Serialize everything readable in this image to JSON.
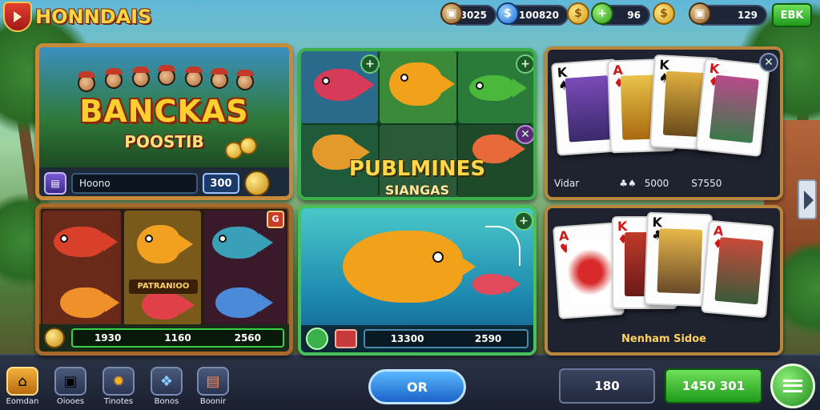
{
  "header": {
    "brand": "HONNDAIS",
    "stats": [
      {
        "icon": "chest-icon",
        "value": "3025"
      },
      {
        "icon": "gem-icon",
        "value": "100820"
      },
      {
        "icon": "leaf-icon",
        "value": "96"
      },
      {
        "icon": "chest-icon",
        "value": "129"
      }
    ],
    "action_button": "EBK"
  },
  "tiles": {
    "banckas": {
      "title": "BANCKAS",
      "subtitle": "POOSTIB",
      "input_value": "Hoono",
      "value": "300"
    },
    "fish_slots": {
      "badge": "G",
      "middle_banner": "PATRANIOO",
      "values": [
        "1930",
        "1160",
        "2560"
      ]
    },
    "fishing_lines": {
      "title": "PUBLMINES",
      "subtitle": "SIANGAS"
    },
    "fish_catch": {
      "value_a": "13300",
      "value_b": "2590"
    },
    "cards_top": {
      "label": "Vidar",
      "value": "5000",
      "value2": "S7550"
    },
    "cards_bottom": {
      "label": "Nenham Sidoe"
    }
  },
  "bottom_nav": [
    {
      "label": "Eomdan",
      "icon": "house-icon"
    },
    {
      "label": "Oiooes",
      "icon": "box-icon"
    },
    {
      "label": "Tinotes",
      "icon": "gear-icon"
    },
    {
      "label": "Bonos",
      "icon": "gift-icon"
    },
    {
      "label": "Boonir",
      "icon": "shop-icon"
    }
  ],
  "buttons": {
    "center": "OR",
    "dark": "180",
    "green": "1450 301"
  }
}
